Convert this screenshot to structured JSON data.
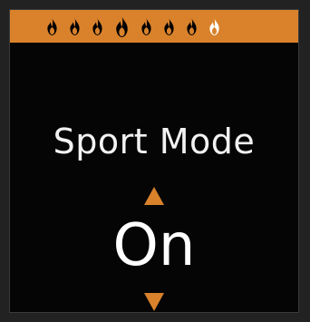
{
  "header": {
    "flame_count": 8,
    "active_flames": 7,
    "colors": {
      "bar": "#d9822b",
      "flame_active": "#000000",
      "flame_inactive": "#ffffff"
    },
    "flames": [
      {
        "icon": "flame-icon",
        "active": true,
        "large": false
      },
      {
        "icon": "flame-icon",
        "active": true,
        "large": false
      },
      {
        "icon": "flame-icon",
        "active": true,
        "large": false
      },
      {
        "icon": "flame-icon",
        "active": true,
        "large": true
      },
      {
        "icon": "flame-icon",
        "active": true,
        "large": false
      },
      {
        "icon": "flame-icon",
        "active": true,
        "large": false
      },
      {
        "icon": "flame-icon",
        "active": true,
        "large": false
      },
      {
        "icon": "flame-icon",
        "active": false,
        "large": false
      }
    ]
  },
  "setting": {
    "title": "Sport Mode",
    "value": "On",
    "up_icon": "triangle-up-icon",
    "down_icon": "triangle-down-icon",
    "accent": "#d9822b"
  }
}
